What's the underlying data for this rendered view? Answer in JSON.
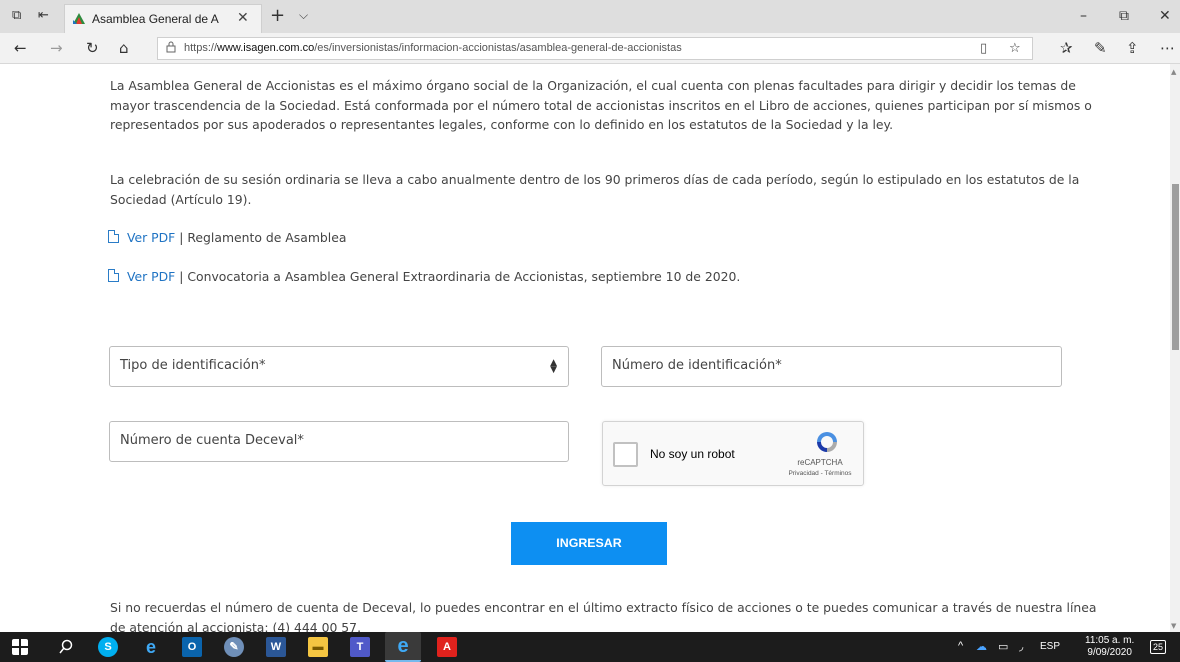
{
  "browser": {
    "tab_title": "Asamblea General de A",
    "url_prefix": "https://",
    "url_domain": "www.isagen.com.co",
    "url_path": "/es/inversionistas/informacion-accionistas/asamblea-general-de-accionistas",
    "icons": {
      "tab_actions": "⧉",
      "tab_aside": "⇤",
      "tab_close": "✕",
      "new_tab": "+",
      "tab_dropdown": "⌵",
      "minimize": "–",
      "maximize": "⧉",
      "window_close": "✕",
      "back": "←",
      "forward": "→",
      "refresh": "↻",
      "home": "⌂",
      "lock": "🔒",
      "reading_view": "▯",
      "favorite": "☆",
      "favorites_hub": "✰",
      "pen": "✎",
      "share": "⇪",
      "more": "⋯"
    }
  },
  "page": {
    "paragraph1": "La Asamblea General de Accionistas es el máximo órgano social de la Organización, el cual cuenta con plenas facultades para dirigir y decidir los temas de mayor trascendencia de la Sociedad. Está conformada por el número total de accionistas inscritos en el Libro de acciones, quienes participan por sí mismos o representados por sus apoderados o representantes legales, conforme con lo definido en los estatutos de la Sociedad y la ley.",
    "paragraph2": "La celebración de su sesión ordinaria se lleva a cabo anualmente dentro de los 90 primeros días de cada período, según lo estipulado en los estatutos de la Sociedad (Artículo 19).",
    "documents": [
      {
        "link": "Ver PDF",
        "separator": " | ",
        "title": "Reglamento de Asamblea"
      },
      {
        "link": "Ver PDF",
        "separator": " | ",
        "title": "Convocatoria a Asamblea General Extraordinaria de Accionistas, septiembre 10 de 2020."
      }
    ],
    "form": {
      "id_type_placeholder": "Tipo de identificación*",
      "id_number_placeholder": "Número de identificación*",
      "deceval_placeholder": "Número de cuenta Deceval*",
      "captcha_label": "No soy un robot",
      "captcha_brand": "reCAPTCHA",
      "captcha_privacy": "Privacidad - Términos",
      "submit_label": "INGRESAR"
    },
    "footer_note": "Si no recuerdas el número de cuenta de Deceval, lo puedes encontrar en el último extracto físico de acciones o te puedes comunicar a través de nuestra línea de atención al accionista: (4) 444 00 57."
  },
  "taskbar": {
    "apps": [
      "windows-start",
      "search",
      "skype",
      "internet-explorer",
      "outlook",
      "paint",
      "word",
      "file-explorer",
      "teams",
      "edge",
      "acrobat"
    ],
    "tray_caret": "^",
    "language": "ESP",
    "time": "11:05 a. m.",
    "date": "9/09/2020",
    "notifications": "25"
  },
  "colors": {
    "accent": "#0d8ff2",
    "link": "#1f73c3",
    "taskbar": "#1c1c1c"
  }
}
